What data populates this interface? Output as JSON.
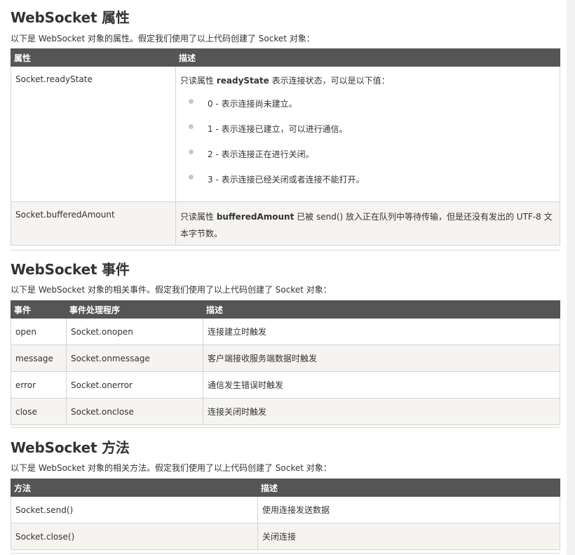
{
  "properties": {
    "title": "WebSocket 属性",
    "description": "以下是 WebSocket 对象的属性。假定我们使用了以上代码创建了 Socket 对象：",
    "headers": [
      "属性",
      "描述"
    ],
    "readyState": {
      "name": "Socket.readyState",
      "desc_prefix": "只读属性 ",
      "desc_bold": "readyState",
      "desc_suffix": " 表示连接状态，可以是以下值：",
      "values": [
        "0 - 表示连接尚未建立。",
        "1 - 表示连接已建立，可以进行通信。",
        "2 - 表示连接正在进行关闭。",
        "3 - 表示连接已经关闭或者连接不能打开。"
      ]
    },
    "bufferedAmount": {
      "name": "Socket.bufferedAmount",
      "desc_prefix": "只读属性 ",
      "desc_bold": "bufferedAmount",
      "desc_suffix": " 已被 send() 放入正在队列中等待传输，但是还没有发出的 UTF-8 文本字节数。"
    }
  },
  "events": {
    "title": "WebSocket 事件",
    "description": "以下是 WebSocket 对象的相关事件。假定我们使用了以上代码创建了 Socket 对象：",
    "headers": [
      "事件",
      "事件处理程序",
      "描述"
    ],
    "rows": [
      {
        "event": "open",
        "handler": "Socket.onopen",
        "desc": "连接建立时触发"
      },
      {
        "event": "message",
        "handler": "Socket.onmessage",
        "desc": "客户端接收服务端数据时触发"
      },
      {
        "event": "error",
        "handler": "Socket.onerror",
        "desc": "通信发生错误时触发"
      },
      {
        "event": "close",
        "handler": "Socket.onclose",
        "desc": "连接关闭时触发"
      }
    ]
  },
  "methods": {
    "title": "WebSocket 方法",
    "description": "以下是 WebSocket 对象的相关方法。假定我们使用了以上代码创建了 Socket 对象：",
    "headers": [
      "方法",
      "描述"
    ],
    "rows": [
      {
        "method": "Socket.send()",
        "desc": "使用连接发送数据"
      },
      {
        "method": "Socket.close()",
        "desc": "关闭连接"
      }
    ]
  },
  "colors": {
    "header_bg": "#555555",
    "alt_row_bg": "#f6f4f0",
    "bullet": "#c8c8c8"
  }
}
